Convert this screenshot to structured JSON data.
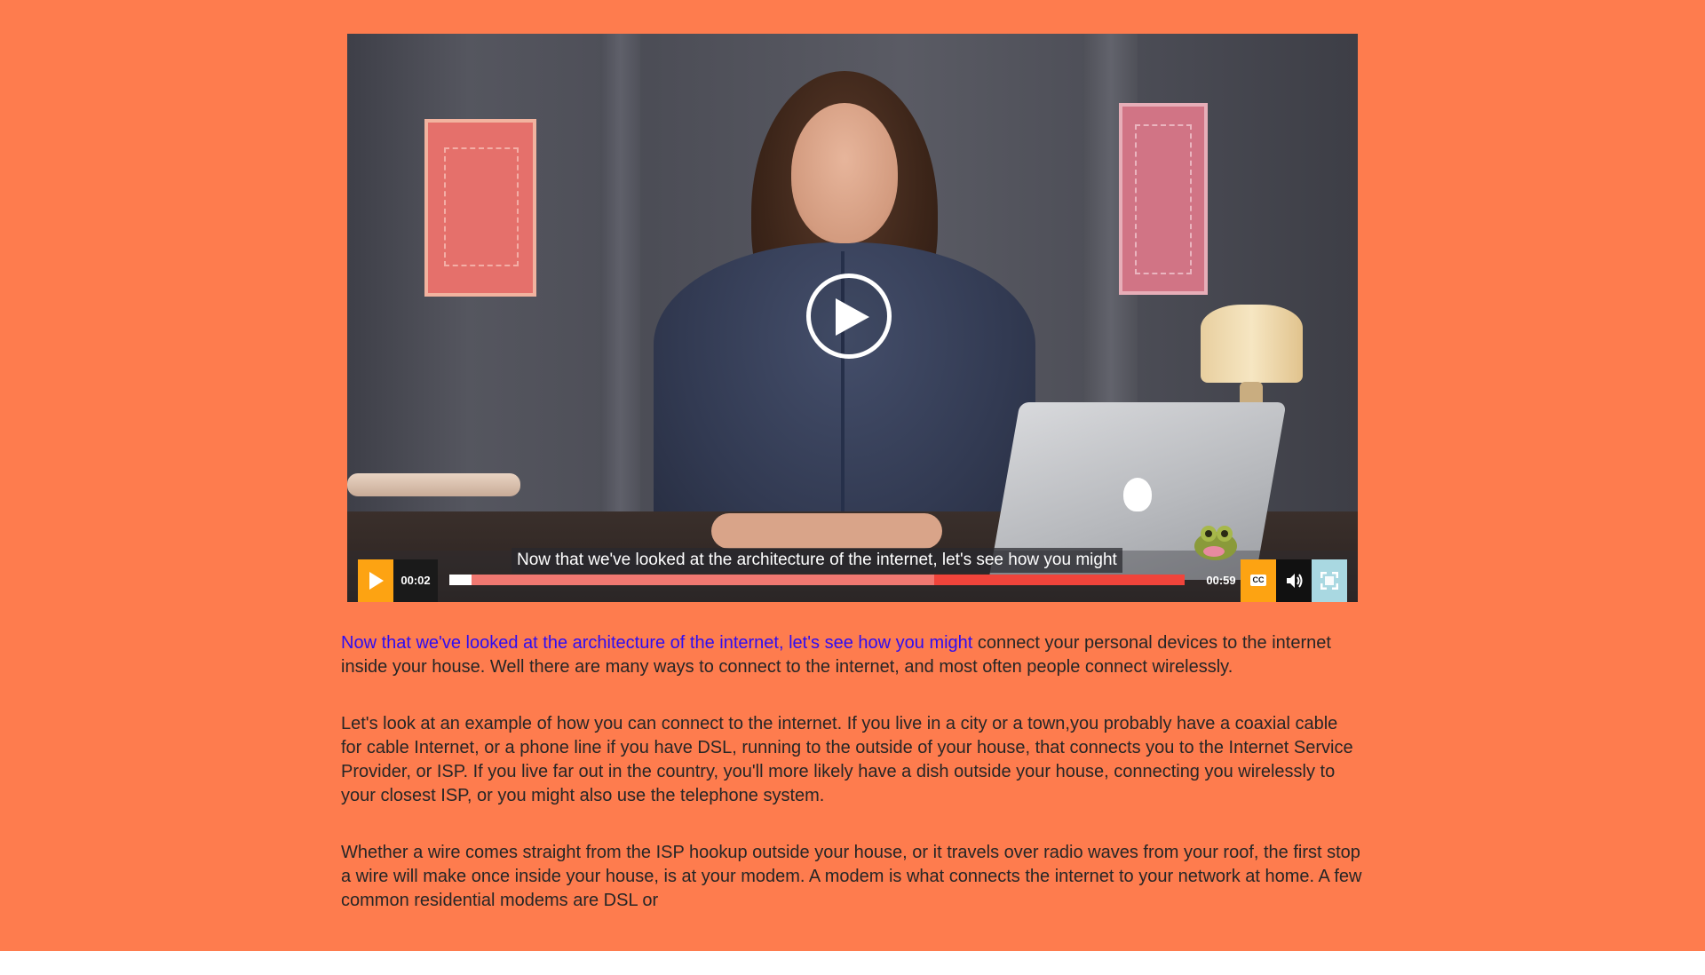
{
  "player": {
    "caption": "Now that we've looked at the architecture of the internet, let's see how you might",
    "current_time": "00:02",
    "duration": "00:59",
    "played_fraction": 0.03,
    "buffered_fraction": 0.66,
    "cc_label": "CC",
    "accent_color": "#fda312",
    "progress_color": "#f0443b"
  },
  "transcript": {
    "p1_highlight": "Now that we've looked at the architecture of the internet, let's see how you might",
    "p1_rest": " connect your personal devices to the internet inside your house. Well there are many ways to connect to the internet, and most often people connect wirelessly.",
    "p2": "Let's look at an example of how you can connect to the internet. If you live in a city or a town,you probably have a coaxial cable for cable Internet, or a phone line if you have DSL, running to the outside of your house, that connects you to the Internet Service Provider, or ISP. If you live far out in the country, you'll more likely have a dish outside your house, connecting you wirelessly to your closest ISP, or you might also use the telephone system.",
    "p3": "Whether a wire comes straight from the ISP hookup outside your house, or it travels over radio waves from your roof, the first stop a wire will make once inside your house, is at your modem. A modem is what connects the internet to your network at home. A few common residential modems are DSL or"
  },
  "colors": {
    "page_background": "#fe7c4e",
    "transcript_highlight": "#2d0df2"
  }
}
